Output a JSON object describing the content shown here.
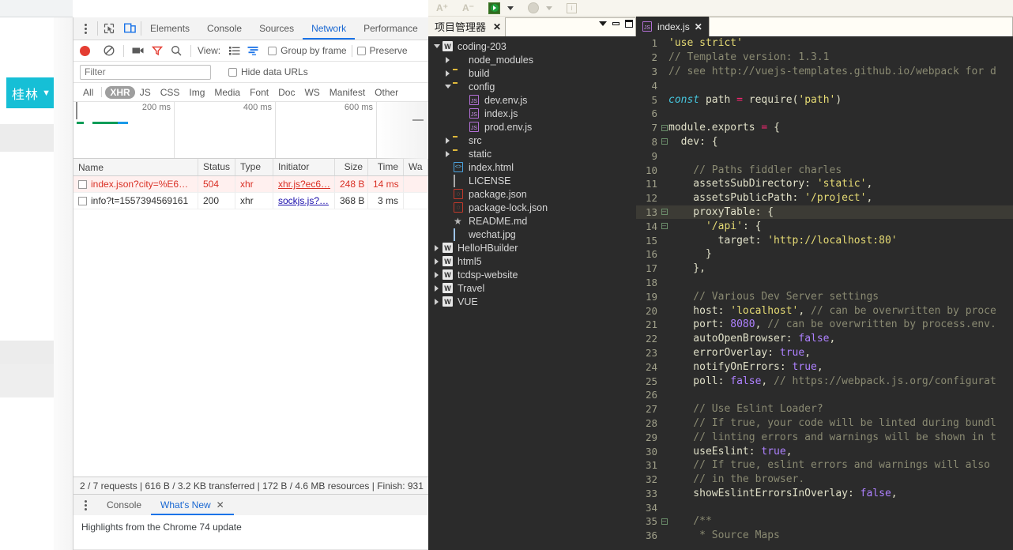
{
  "background_page": {
    "city_button": {
      "label": "桂林",
      "caret": "▼",
      "color": "#16bfd6"
    }
  },
  "devtools": {
    "tabs": [
      {
        "label": "Elements",
        "active": false
      },
      {
        "label": "Console",
        "active": false
      },
      {
        "label": "Sources",
        "active": false
      },
      {
        "label": "Network",
        "active": true
      },
      {
        "label": "Performance",
        "active": false
      }
    ],
    "left_icons": [
      "more-vertical-icon",
      "inspect-element-icon",
      "device-toolbar-icon"
    ],
    "toolbar": {
      "record_label": "record-button",
      "clear_label": "clear-button",
      "capture_screenshots_label": "camera-icon",
      "filter_toggle_label": "filter-funnel-icon",
      "search_label": "search-icon",
      "view_label": "View:",
      "view_list_icon": "list-view-icon",
      "view_waterfall_icon": "waterfall-view-icon",
      "group_by_frame": "Group by frame",
      "preserve_log": "Preserve"
    },
    "filter": {
      "placeholder": "Filter",
      "value": "",
      "hide_data_urls": "Hide data URLs"
    },
    "type_filters": [
      {
        "label": "All",
        "active": false
      },
      {
        "label": "XHR",
        "active": true
      },
      {
        "label": "JS",
        "active": false
      },
      {
        "label": "CSS",
        "active": false
      },
      {
        "label": "Img",
        "active": false
      },
      {
        "label": "Media",
        "active": false
      },
      {
        "label": "Font",
        "active": false
      },
      {
        "label": "Doc",
        "active": false
      },
      {
        "label": "WS",
        "active": false
      },
      {
        "label": "Manifest",
        "active": false
      },
      {
        "label": "Other",
        "active": false
      }
    ],
    "overview": {
      "ticks": [
        "200 ms",
        "400 ms",
        "600 ms"
      ],
      "bar_colors": {
        "green": "#0f9d58",
        "blue": "#1a9ae8"
      }
    },
    "table": {
      "columns": [
        "Name",
        "Status",
        "Type",
        "Initiator",
        "Size",
        "Time",
        "Wa"
      ],
      "rows": [
        {
          "name": "index.json?city=%E6…",
          "status": "504",
          "type": "xhr",
          "initiator": "xhr.js?ec6…",
          "size": "248 B",
          "time": "14 ms",
          "error": true
        },
        {
          "name": "info?t=1557394569161",
          "status": "200",
          "type": "xhr",
          "initiator": "sockjs.js?…",
          "size": "368 B",
          "time": "3 ms",
          "error": false
        }
      ]
    },
    "status_bar": "2 / 7 requests | 616 B / 3.2 KB transferred | 172 B / 4.6 MB resources | Finish: 931",
    "drawer": {
      "tabs": [
        {
          "label": "Console",
          "active": false,
          "closable": false
        },
        {
          "label": "What's New",
          "active": true,
          "closable": true
        }
      ],
      "close_glyph": "✕",
      "body_text": "Highlights from the Chrome 74 update"
    }
  },
  "hbuilder": {
    "toolbar": {
      "font_increase": "A⁺",
      "font_decrease": "A⁻",
      "run_button": "run-icon",
      "run_caret": "▼",
      "debug_button": "debug-icon",
      "debug_caret": "▼",
      "info_button": "i"
    },
    "project_manager": {
      "title": "项目管理器",
      "close_glyph": "✕",
      "window_buttons": [
        "panel-menu",
        "minimize",
        "maximize"
      ],
      "tree": [
        {
          "depth": 0,
          "label": "coding-203",
          "icon": "workspace-icon",
          "arrow": "down",
          "selected": false
        },
        {
          "depth": 1,
          "label": "node_modules",
          "icon": "node-modules-icon",
          "arrow": "right"
        },
        {
          "depth": 1,
          "label": "build",
          "icon": "folder-icon",
          "arrow": "right"
        },
        {
          "depth": 1,
          "label": "config",
          "icon": "folder-icon",
          "arrow": "down"
        },
        {
          "depth": 2,
          "label": "dev.env.js",
          "icon": "js-file-icon",
          "arrow": "none"
        },
        {
          "depth": 2,
          "label": "index.js",
          "icon": "js-file-icon",
          "arrow": "none"
        },
        {
          "depth": 2,
          "label": "prod.env.js",
          "icon": "js-file-icon",
          "arrow": "none"
        },
        {
          "depth": 1,
          "label": "src",
          "icon": "folder-icon",
          "arrow": "right"
        },
        {
          "depth": 1,
          "label": "static",
          "icon": "folder-icon",
          "arrow": "right"
        },
        {
          "depth": 1,
          "label": "index.html",
          "icon": "html-file-icon",
          "arrow": "none"
        },
        {
          "depth": 1,
          "label": "LICENSE",
          "icon": "text-file-icon",
          "arrow": "none"
        },
        {
          "depth": 1,
          "label": "package.json",
          "icon": "json-file-icon",
          "arrow": "none"
        },
        {
          "depth": 1,
          "label": "package-lock.json",
          "icon": "json-file-icon",
          "arrow": "none"
        },
        {
          "depth": 1,
          "label": "README.md",
          "icon": "star-icon",
          "arrow": "none"
        },
        {
          "depth": 1,
          "label": "wechat.jpg",
          "icon": "image-file-icon",
          "arrow": "none"
        },
        {
          "depth": 0,
          "label": "HelloHBuilder",
          "icon": "workspace-icon",
          "arrow": "right"
        },
        {
          "depth": 0,
          "label": "html5",
          "icon": "workspace-icon",
          "arrow": "right"
        },
        {
          "depth": 0,
          "label": "tcdsp-website",
          "icon": "workspace-icon",
          "arrow": "right"
        },
        {
          "depth": 0,
          "label": "Travel",
          "icon": "workspace-icon",
          "arrow": "right"
        },
        {
          "depth": 0,
          "label": "VUE",
          "icon": "workspace-icon",
          "arrow": "right"
        }
      ]
    },
    "editor": {
      "tab": {
        "label": "index.js",
        "icon": "js-file-icon",
        "close_glyph": "✕"
      },
      "highlighted_line": 13,
      "lines": [
        {
          "n": 1,
          "fold": "",
          "code": "'use strict'"
        },
        {
          "n": 2,
          "fold": "",
          "code": "// Template version: 1.3.1"
        },
        {
          "n": 3,
          "fold": "",
          "code": "// see http://vuejs-templates.github.io/webpack for d"
        },
        {
          "n": 4,
          "fold": "",
          "code": ""
        },
        {
          "n": 5,
          "fold": "",
          "code": "const path = require('path')"
        },
        {
          "n": 6,
          "fold": "",
          "code": ""
        },
        {
          "n": 7,
          "fold": "-",
          "code": "module.exports = {"
        },
        {
          "n": 8,
          "fold": "-",
          "code": "  dev: {"
        },
        {
          "n": 9,
          "fold": "",
          "code": ""
        },
        {
          "n": 10,
          "fold": "",
          "code": "    // Paths fiddler charles"
        },
        {
          "n": 11,
          "fold": "",
          "code": "    assetsSubDirectory: 'static',"
        },
        {
          "n": 12,
          "fold": "",
          "code": "    assetsPublicPath: '/project',"
        },
        {
          "n": 13,
          "fold": "-",
          "code": "    proxyTable: {"
        },
        {
          "n": 14,
          "fold": "-",
          "code": "      '/api': {"
        },
        {
          "n": 15,
          "fold": "",
          "code": "        target: 'http://localhost:80'"
        },
        {
          "n": 16,
          "fold": "",
          "code": "      }"
        },
        {
          "n": 17,
          "fold": "",
          "code": "    },"
        },
        {
          "n": 18,
          "fold": "",
          "code": ""
        },
        {
          "n": 19,
          "fold": "",
          "code": "    // Various Dev Server settings"
        },
        {
          "n": 20,
          "fold": "",
          "code": "    host: 'localhost', // can be overwritten by proce"
        },
        {
          "n": 21,
          "fold": "",
          "code": "    port: 8080, // can be overwritten by process.env."
        },
        {
          "n": 22,
          "fold": "",
          "code": "    autoOpenBrowser: false,"
        },
        {
          "n": 23,
          "fold": "",
          "code": "    errorOverlay: true,"
        },
        {
          "n": 24,
          "fold": "",
          "code": "    notifyOnErrors: true,"
        },
        {
          "n": 25,
          "fold": "",
          "code": "    poll: false, // https://webpack.js.org/configurat"
        },
        {
          "n": 26,
          "fold": "",
          "code": ""
        },
        {
          "n": 27,
          "fold": "",
          "code": "    // Use Eslint Loader?"
        },
        {
          "n": 28,
          "fold": "",
          "code": "    // If true, your code will be linted during bundl"
        },
        {
          "n": 29,
          "fold": "",
          "code": "    // linting errors and warnings will be shown in t"
        },
        {
          "n": 30,
          "fold": "",
          "code": "    useEslint: true,"
        },
        {
          "n": 31,
          "fold": "",
          "code": "    // If true, eslint errors and warnings will also"
        },
        {
          "n": 32,
          "fold": "",
          "code": "    // in the browser."
        },
        {
          "n": 33,
          "fold": "",
          "code": "    showEslintErrorsInOverlay: false,"
        },
        {
          "n": 34,
          "fold": "",
          "code": ""
        },
        {
          "n": 35,
          "fold": "-",
          "code": "    /**"
        },
        {
          "n": 36,
          "fold": "",
          "code": "     * Source Maps"
        }
      ]
    }
  }
}
